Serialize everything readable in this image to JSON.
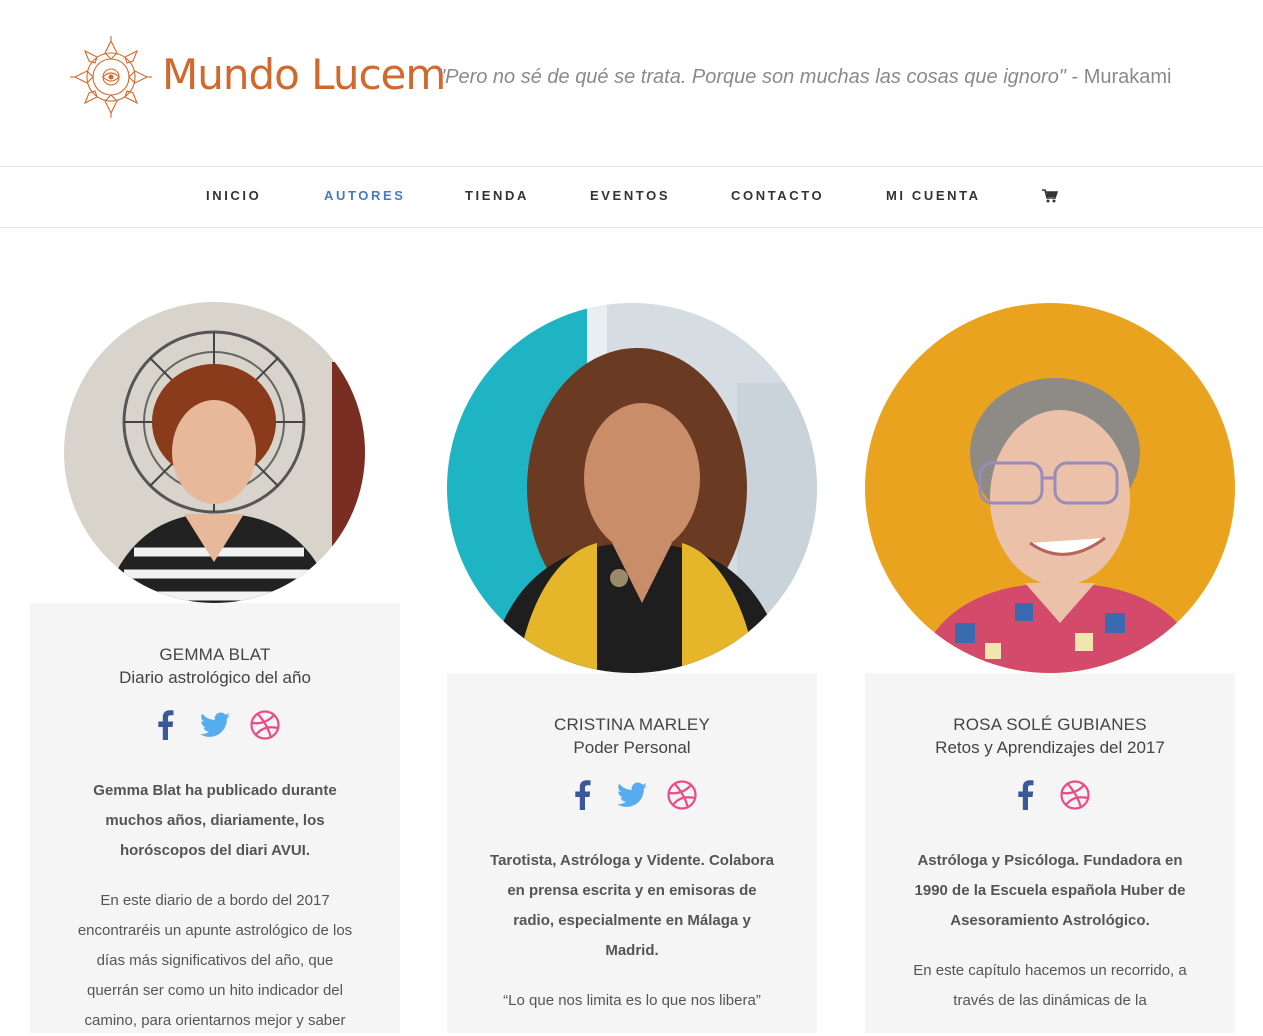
{
  "brand": {
    "name": "Mundo Lucem",
    "color": "#d2692c"
  },
  "header": {
    "quote": "\"Pero no sé de qué se trata. Porque son muchas las cosas que ignoro\"",
    "quote_author": " - Murakami"
  },
  "nav": {
    "items": [
      "INICIO",
      "AUTORES",
      "TIENDA",
      "EVENTOS",
      "CONTACTO",
      "MI CUENTA"
    ],
    "active": "AUTORES",
    "cart_icon": "shopping-cart-icon"
  },
  "authors": [
    {
      "name": "GEMMA BLAT",
      "book": "Diario astrológico del año",
      "socials": [
        "facebook-icon",
        "twitter-icon",
        "dribbble-icon"
      ],
      "bio": "Gemma Blat ha publicado durante muchos años, diariamente, los horóscopos del diari AVUI.",
      "description": "En este diario de a bordo del 2017 encontraréis un apunte astrológico de los días más significativos del año, que querrán ser como un hito indicador del camino, para orientarnos mejor y saber"
    },
    {
      "name": "CRISTINA MARLEY",
      "book": "Poder Personal",
      "socials": [
        "facebook-icon",
        "twitter-icon",
        "dribbble-icon"
      ],
      "bio": "Tarotista, Astróloga y Vidente. Colabora en prensa escrita y en emisoras de radio, especialmente en Málaga y Madrid.",
      "description": "“Lo que nos limita es lo que nos libera”"
    },
    {
      "name": "ROSA SOLÉ GUBIANES",
      "book": "Retos y Aprendizajes del 2017",
      "socials": [
        "facebook-icon",
        "dribbble-icon"
      ],
      "bio": "Astróloga y Psicóloga. Fundadora en 1990 de la Escuela española Huber de Asesoramiento Astrológico.",
      "description": "En este capítulo hacemos un recorrido, a través de las dinámicas de la"
    }
  ],
  "colors": {
    "facebook": "#3b5998",
    "twitter": "#55acee",
    "dribbble": "#ea4c89",
    "nav_active": "#4a78c2",
    "card_bg": "#f5f5f5"
  }
}
